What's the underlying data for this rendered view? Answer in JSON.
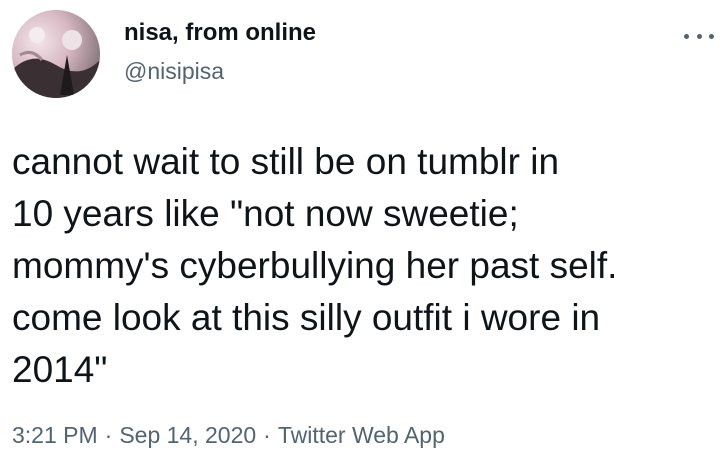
{
  "author": {
    "display_name": "nisa, from online",
    "handle": "@nisipisa",
    "avatar_icon": "profile-photo"
  },
  "more_icon": "more-dots-icon",
  "tweet": {
    "lines": [
      "cannot wait to still be on tumblr in",
      "10 years like \"not now sweetie;",
      "mommy's cyberbullying her past self.",
      "come look at this silly outfit i wore in",
      "2014\""
    ]
  },
  "meta": {
    "time": "3:21 PM",
    "separator": "·",
    "date": "Sep 14, 2020",
    "source": "Twitter Web App"
  },
  "colors": {
    "text_primary": "#0f1419",
    "text_secondary": "#536471",
    "background": "#ffffff"
  }
}
